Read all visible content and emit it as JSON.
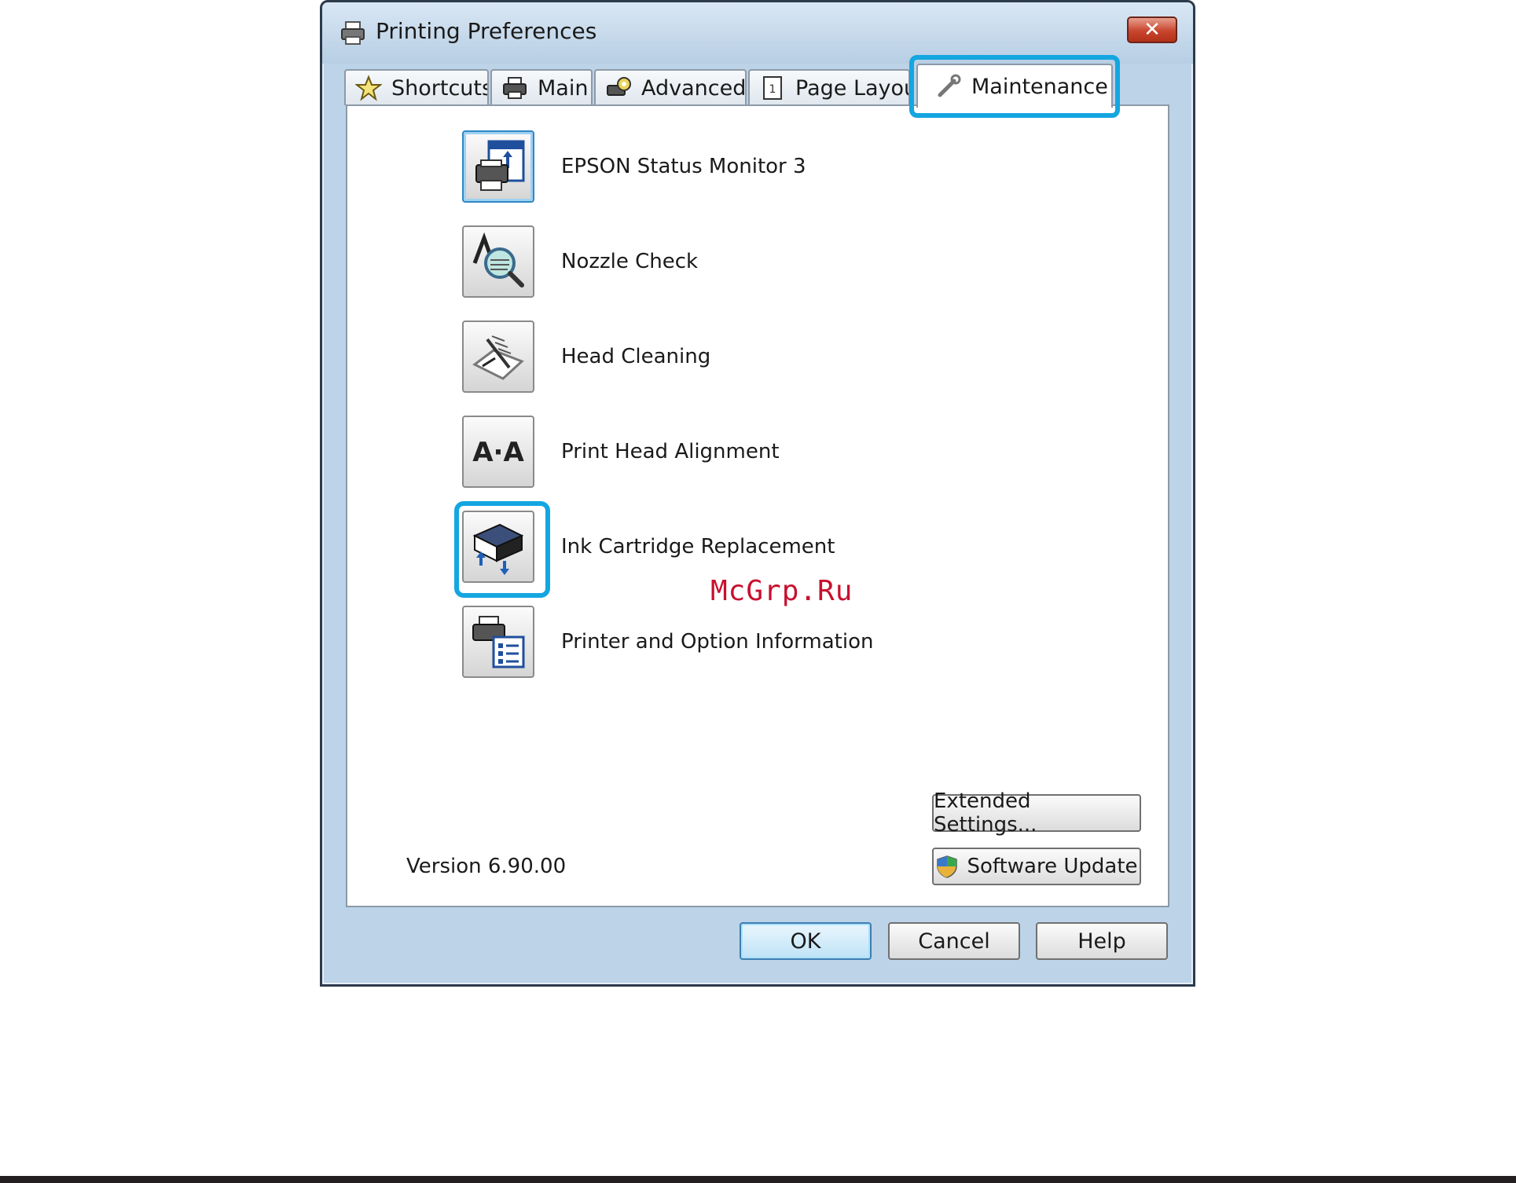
{
  "window": {
    "title": "Printing Preferences",
    "close_label": "✕"
  },
  "tabs": [
    {
      "label": "Shortcuts",
      "icon": "star-icon"
    },
    {
      "label": "Main",
      "icon": "printer-icon"
    },
    {
      "label": "Advanced",
      "icon": "gear-printer-icon"
    },
    {
      "label": "Page Layou",
      "icon": "page-icon"
    },
    {
      "label": "Maintenance",
      "icon": "wrench-icon",
      "active": true
    }
  ],
  "maintenance": {
    "items": [
      {
        "label": "EPSON Status Monitor 3",
        "icon": "status-monitor-icon"
      },
      {
        "label": "Nozzle Check",
        "icon": "nozzle-check-icon"
      },
      {
        "label": "Head Cleaning",
        "icon": "head-cleaning-icon"
      },
      {
        "label": "Print Head Alignment",
        "icon": "print-head-alignment-icon",
        "glyph": "A·A"
      },
      {
        "label": "Ink Cartridge Replacement",
        "icon": "ink-cartridge-icon"
      },
      {
        "label": "Printer and Option Information",
        "icon": "printer-info-icon"
      }
    ],
    "version": "Version 6.90.00",
    "extended_settings": "Extended Settings...",
    "software_update": "Software Update"
  },
  "watermark": "McGrp.Ru",
  "buttons": {
    "ok": "OK",
    "cancel": "Cancel",
    "help": "Help"
  },
  "colors": {
    "highlight": "#14a6e0",
    "watermark": "#c8102e"
  }
}
